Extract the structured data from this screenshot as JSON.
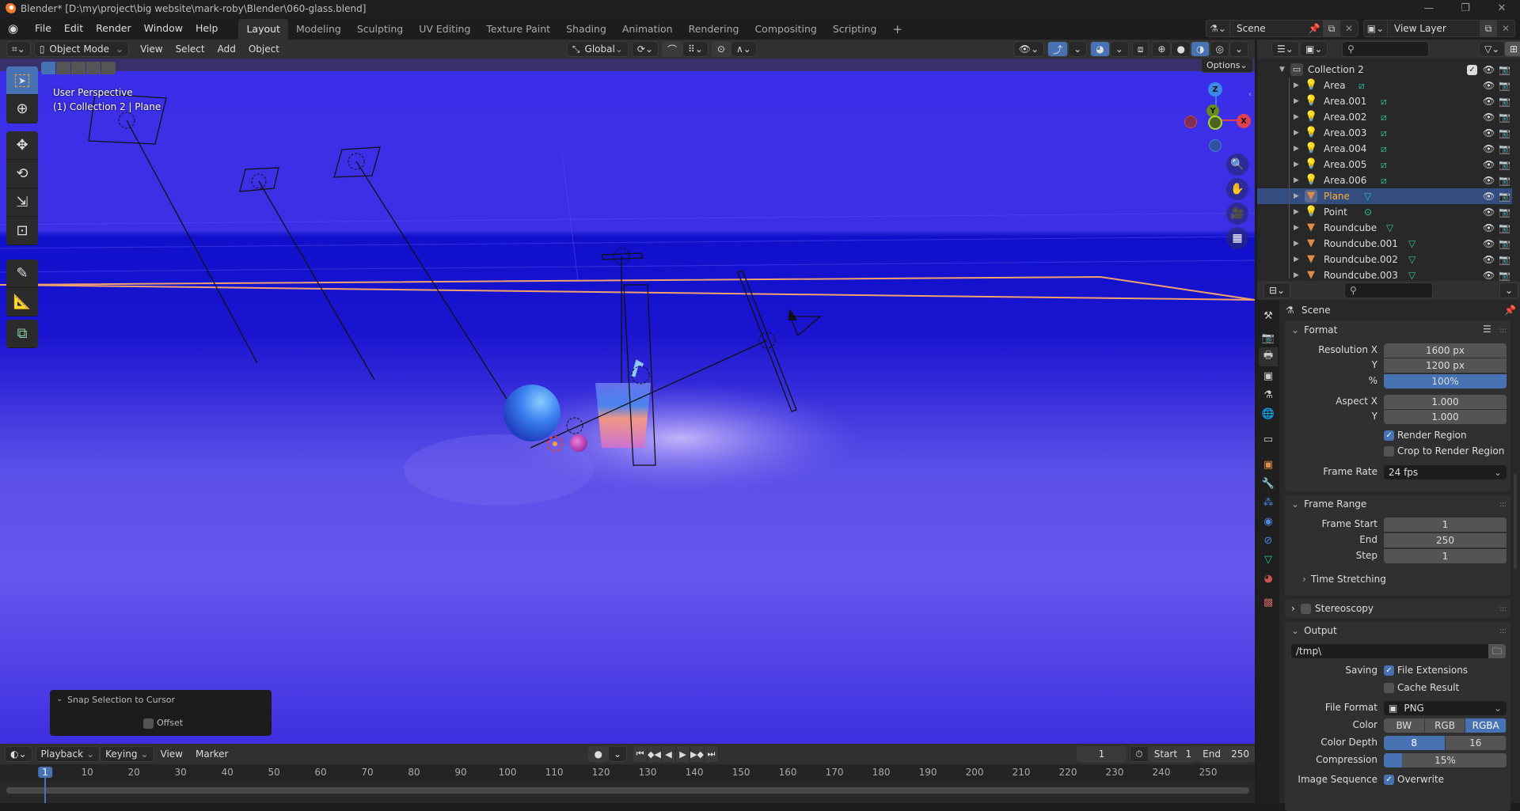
{
  "window": {
    "title": "Blender* [D:\\my\\project\\big website\\mark-roby\\Blender\\060-glass.blend]",
    "controls": [
      "minimize",
      "maximize",
      "close"
    ]
  },
  "menubar": {
    "menus": [
      "File",
      "Edit",
      "Render",
      "Window",
      "Help"
    ],
    "workspaces": [
      "Layout",
      "Modeling",
      "Sculpting",
      "UV Editing",
      "Texture Paint",
      "Shading",
      "Animation",
      "Rendering",
      "Compositing",
      "Scripting"
    ],
    "active_workspace": "Layout",
    "add_workspace": "+",
    "scene": "Scene",
    "view_layer": "View Layer"
  },
  "viewport_header": {
    "mode": "Object Mode",
    "menus": [
      "View",
      "Select",
      "Add",
      "Object"
    ],
    "transform_orientation": "Global",
    "options": "Options"
  },
  "viewport": {
    "view_name": "User Perspective",
    "context": "(1) Collection 2 | Plane",
    "gizmo_axes": [
      "Z",
      "Y",
      "X"
    ],
    "nav_buttons": [
      "zoom",
      "pan",
      "camera",
      "ortho-toggle"
    ],
    "tools": [
      "select-box",
      "cursor",
      "move",
      "rotate",
      "scale",
      "transform",
      "annotate",
      "measure",
      "add-cube"
    ],
    "active_tool": "select-box"
  },
  "last_operator": {
    "title": "Snap Selection to Cursor",
    "offset_label": "Offset",
    "offset_checked": false
  },
  "timeline": {
    "menus": [
      "Playback",
      "Keying",
      "View",
      "Marker"
    ],
    "current_frame": "1",
    "start_label": "Start",
    "start": "1",
    "end_label": "End",
    "end": "250",
    "ruler": [
      "1",
      "10",
      "20",
      "30",
      "40",
      "50",
      "60",
      "70",
      "80",
      "90",
      "100",
      "110",
      "120",
      "130",
      "140",
      "150",
      "160",
      "170",
      "180",
      "190",
      "200",
      "210",
      "220",
      "230",
      "240",
      "250"
    ]
  },
  "outliner": {
    "collection": "Collection 2",
    "items": [
      {
        "name": "Area",
        "type": "light",
        "data": "area-light"
      },
      {
        "name": "Area.001",
        "type": "light",
        "data": "area-light"
      },
      {
        "name": "Area.002",
        "type": "light",
        "data": "area-light"
      },
      {
        "name": "Area.003",
        "type": "light",
        "data": "area-light"
      },
      {
        "name": "Area.004",
        "type": "light",
        "data": "area-light"
      },
      {
        "name": "Area.005",
        "type": "light",
        "data": "area-light"
      },
      {
        "name": "Area.006",
        "type": "light",
        "data": "area-light"
      },
      {
        "name": "Plane",
        "type": "mesh",
        "data": "mesh",
        "selected": true
      },
      {
        "name": "Point",
        "type": "light",
        "data": "point-light"
      },
      {
        "name": "Roundcube",
        "type": "mesh",
        "data": "mesh"
      },
      {
        "name": "Roundcube.001",
        "type": "mesh",
        "data": "mesh"
      },
      {
        "name": "Roundcube.002",
        "type": "mesh",
        "data": "mesh"
      },
      {
        "name": "Roundcube.003",
        "type": "mesh",
        "data": "mesh"
      }
    ]
  },
  "properties": {
    "context": "Scene",
    "active_tab": "output",
    "format": {
      "title": "Format",
      "resolution_x_label": "Resolution X",
      "resolution_x": "1600 px",
      "resolution_y_label": "Y",
      "resolution_y": "1200 px",
      "percent_label": "%",
      "percent": "100%",
      "aspect_x_label": "Aspect X",
      "aspect_x": "1.000",
      "aspect_y_label": "Y",
      "aspect_y": "1.000",
      "render_region": "Render Region",
      "render_region_checked": true,
      "crop": "Crop to Render Region",
      "crop_checked": false,
      "frame_rate_label": "Frame Rate",
      "frame_rate": "24 fps"
    },
    "frame_range": {
      "title": "Frame Range",
      "start_label": "Frame Start",
      "start": "1",
      "end_label": "End",
      "end": "250",
      "step_label": "Step",
      "step": "1",
      "time_stretching": "Time Stretching"
    },
    "stereoscopy": {
      "title": "Stereoscopy",
      "checked": false
    },
    "output": {
      "title": "Output",
      "path": "/tmp\\",
      "saving_label": "Saving",
      "file_extensions": "File Extensions",
      "file_extensions_checked": true,
      "cache_result": "Cache Result",
      "cache_result_checked": false,
      "file_format_label": "File Format",
      "file_format": "PNG",
      "color_label": "Color",
      "color_options": [
        "BW",
        "RGB",
        "RGBA"
      ],
      "color_selected": "RGBA",
      "color_depth_label": "Color Depth",
      "color_depth_options": [
        "8",
        "16"
      ],
      "color_depth_selected": "8",
      "compression_label": "Compression",
      "compression": "15%",
      "compression_value": 0.15,
      "image_sequence_label": "Image Sequence",
      "overwrite": "Overwrite",
      "overwrite_checked": true
    }
  },
  "colors": {
    "accent": "#4772b3",
    "selected_name": "#ffaf29",
    "object_orange": "#e08c44",
    "data_green": "#2ec4a0"
  }
}
